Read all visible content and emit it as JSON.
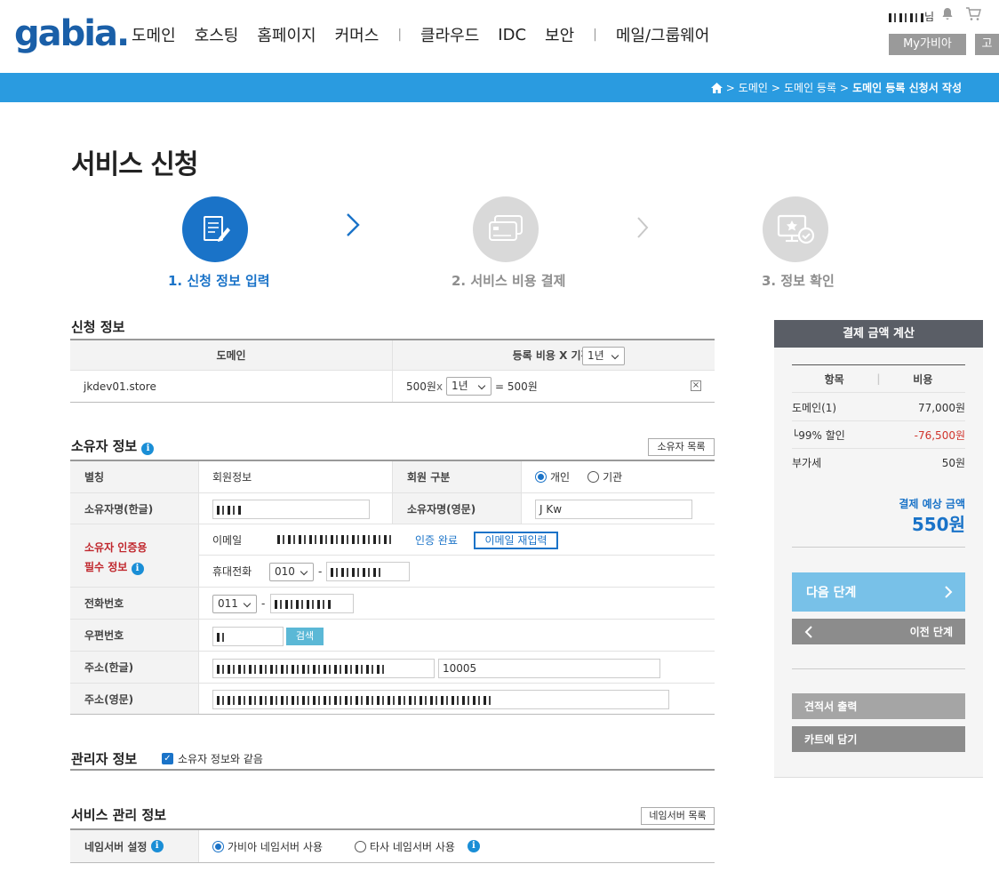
{
  "header": {
    "logo": "gabia.",
    "nav": [
      "도메인",
      "호스팅",
      "홈페이지",
      "커머스",
      "클라우드",
      "IDC",
      "보안",
      "메일/그룹웨어"
    ],
    "separator": "|",
    "user_greeting": "님",
    "my_label": "My가비아",
    "cs_label": "고"
  },
  "breadcrumb": {
    "items": [
      "도메인",
      "도메인 등록"
    ],
    "current": "도메인 등록 신청서 작성",
    "sep": ">"
  },
  "page": {
    "title": "서비스 신청"
  },
  "steps": [
    {
      "label": "1. 신청 정보 입력",
      "icon": "form-edit-icon",
      "active": true
    },
    {
      "label": "2. 서비스 비용 결제",
      "icon": "credit-card-icon",
      "active": false
    },
    {
      "label": "3. 정보 확인",
      "icon": "monitor-check-icon",
      "active": false
    }
  ],
  "apply_info": {
    "title": "신청 정보",
    "col_domain": "도메인",
    "col_cost": "등록 비용 X 기간:",
    "period_select": "1년",
    "rows": [
      {
        "domain": "jkdev01.store",
        "price": "500원",
        "x": "x",
        "period": "1년",
        "eq": "= 500원",
        "remove": "×"
      }
    ]
  },
  "owner": {
    "title": "소유자 정보",
    "list_button": "소유자 목록",
    "alias_label": "별칭",
    "alias_value": "회원정보",
    "member_type_label": "회원 구분",
    "member_types": [
      "개인",
      "기관"
    ],
    "member_type_selected": "개인",
    "name_kr_label": "소유자명(한글)",
    "name_en_label": "소유자명(영문)",
    "name_en_value": "J   Kw",
    "auth_label_1": "소유자 인증용",
    "auth_label_2": "필수 정보",
    "email_label": "이메일",
    "auth_done": "인증 완료",
    "email_reenter": "이메일 재입력",
    "mobile_label": "휴대전화",
    "mobile_prefix": "010",
    "dash": "-",
    "phone_label": "전화번호",
    "phone_prefix": "011",
    "zip_label": "우편번호",
    "zip_search": "검색",
    "addr_kr_label": "주소(한글)",
    "addr_kr_zip": "10005",
    "addr_en_label": "주소(영문)"
  },
  "admin": {
    "title": "관리자 정보",
    "same_label": "소유자 정보와 같음"
  },
  "service": {
    "title": "서비스 관리 정보",
    "ns_list_button": "네임서버 목록",
    "ns_label": "네임서버 설정",
    "ns_options": [
      "가비아 네임서버 사용",
      "타사 네임서버 사용"
    ],
    "ns_selected": "가비아 네임서버 사용"
  },
  "sidebar": {
    "title": "결제 금액 계산",
    "col_item": "항목",
    "col_cost": "비용",
    "rows": [
      {
        "item": "도메인(1)",
        "cost": "77,000원"
      },
      {
        "item": "└99% 할인",
        "cost": "-76,500원"
      },
      {
        "item": "부가세",
        "cost": "50원"
      }
    ],
    "total_label": "결제 예상 금액",
    "total_value": "550원",
    "next_button": "다음 단계",
    "prev_button": "이전 단계",
    "quote_button": "견적서 출력",
    "cart_button": "카트에 담기"
  },
  "colors": {
    "brand": "#1a5fa8",
    "bar": "#2a9be0",
    "active_step": "#1a73c8",
    "inactive_step": "#d9d9d9",
    "discount": "#d0342c",
    "required": "#c0272d"
  }
}
